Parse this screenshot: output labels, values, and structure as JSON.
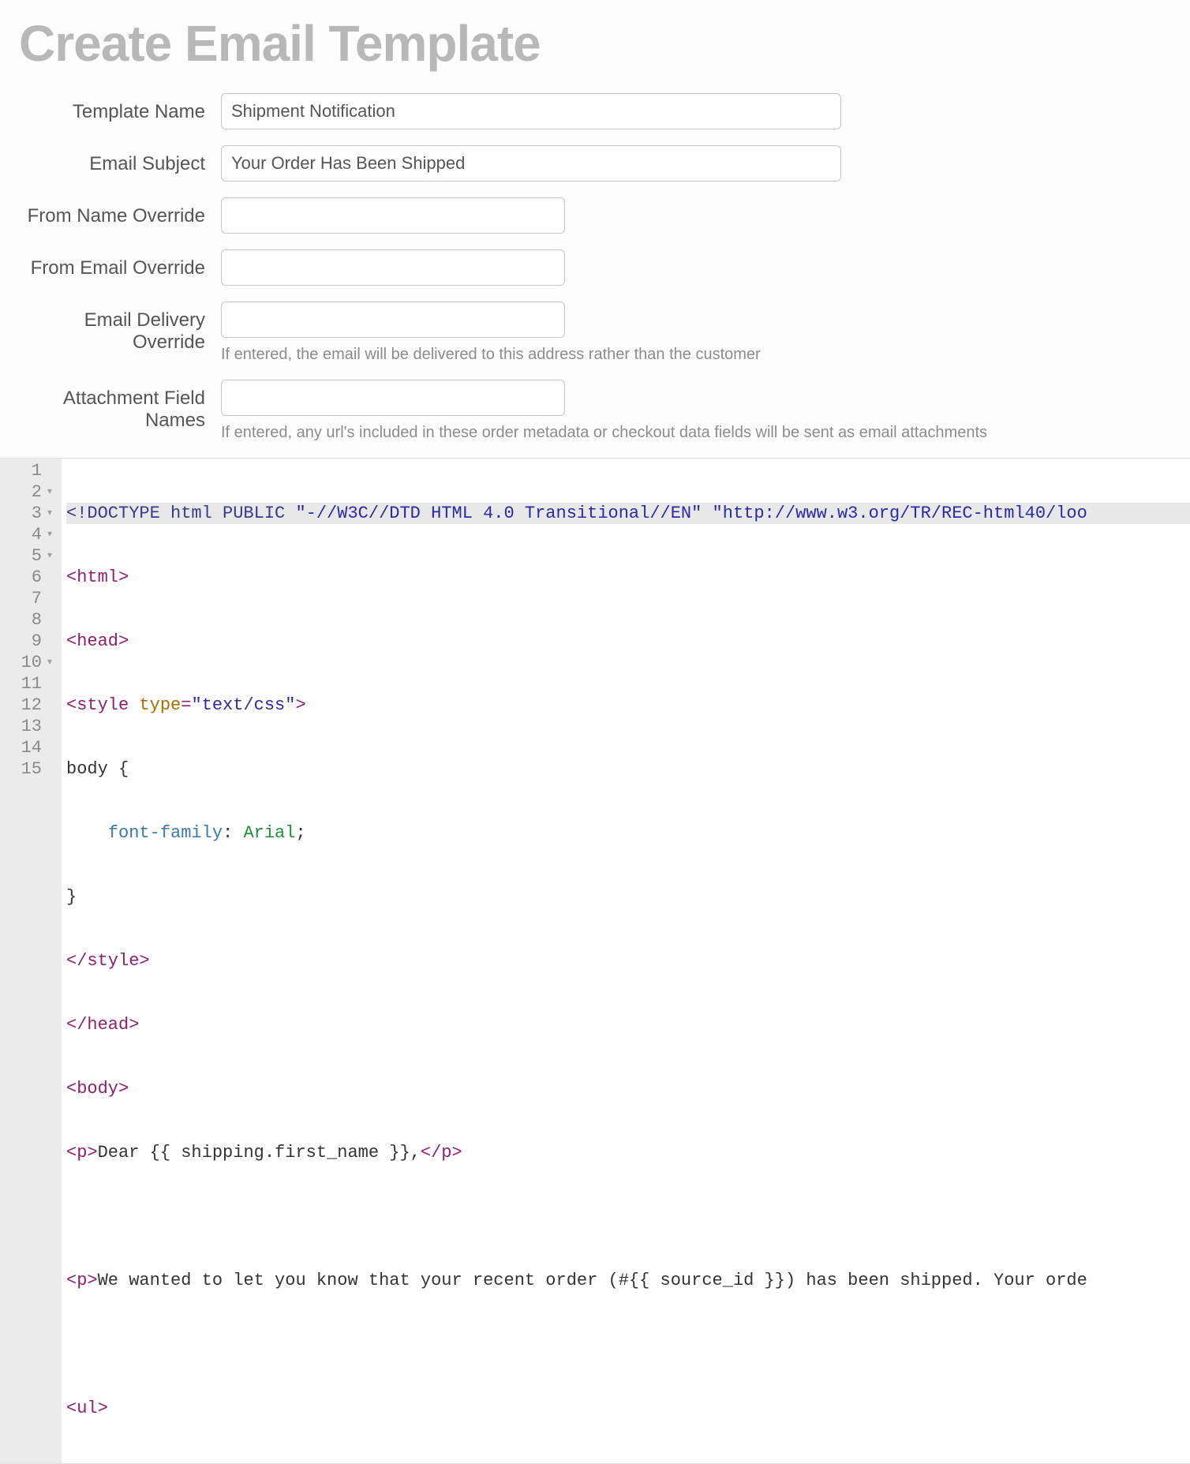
{
  "page": {
    "title": "Create Email Template"
  },
  "form": {
    "template_name": {
      "label": "Template Name",
      "value": "Shipment Notification"
    },
    "email_subject": {
      "label": "Email Subject",
      "value": "Your Order Has Been Shipped"
    },
    "from_name_override": {
      "label": "From Name Override",
      "value": ""
    },
    "from_email_override": {
      "label": "From Email Override",
      "value": ""
    },
    "email_delivery_override": {
      "label": "Email Delivery Override",
      "value": "",
      "help": "If entered, the email will be delivered to this address rather than the customer"
    },
    "attachment_field_names": {
      "label": "Attachment Field Names",
      "value": "",
      "help": "If entered, any url's included in these order metadata or checkout data fields will be sent as email attachments"
    }
  },
  "editor": {
    "line_numbers": [
      "1",
      "2",
      "3",
      "4",
      "5",
      "6",
      "7",
      "8",
      "9",
      "10",
      "11",
      "12",
      "13",
      "14",
      "15"
    ],
    "fold_lines": [
      2,
      3,
      4,
      5,
      10
    ],
    "lines": {
      "l1_doctype_a": "<!DOCTYPE html PUBLIC ",
      "l1_doctype_s1": "\"-//W3C//DTD HTML 4.0 Transitional//EN\"",
      "l1_doctype_sp": " ",
      "l1_doctype_s2": "\"http://www.w3.org/TR/REC-html40/loo",
      "l2_tag": "<html>",
      "l3_tag": "<head>",
      "l4_open": "<style",
      "l4_sp": " ",
      "l4_attr": "type",
      "l4_eq": "=",
      "l4_val": "\"text/css\"",
      "l4_close": ">",
      "l5_sel": "body {",
      "l6_indent": "    ",
      "l6_prop": "font-family",
      "l6_colon": ": ",
      "l6_val": "Arial",
      "l6_semi": ";",
      "l7_brace": "}",
      "l8_tag": "</style>",
      "l9_tag": "</head>",
      "l10_tag": "<body>",
      "l11_open": "<p>",
      "l11_text_a": "Dear ",
      "l11_tmpl": "{{ shipping.first_name }}",
      "l11_text_b": ",",
      "l11_close": "</p>",
      "l12_blank": "",
      "l13_open": "<p>",
      "l13_text_a": "We wanted to let you know that your recent order (#",
      "l13_tmpl": "{{ source_id }}",
      "l13_text_b": ") has been shipped. Your orde",
      "l14_blank": "",
      "l15_tag": "<ul>"
    }
  }
}
